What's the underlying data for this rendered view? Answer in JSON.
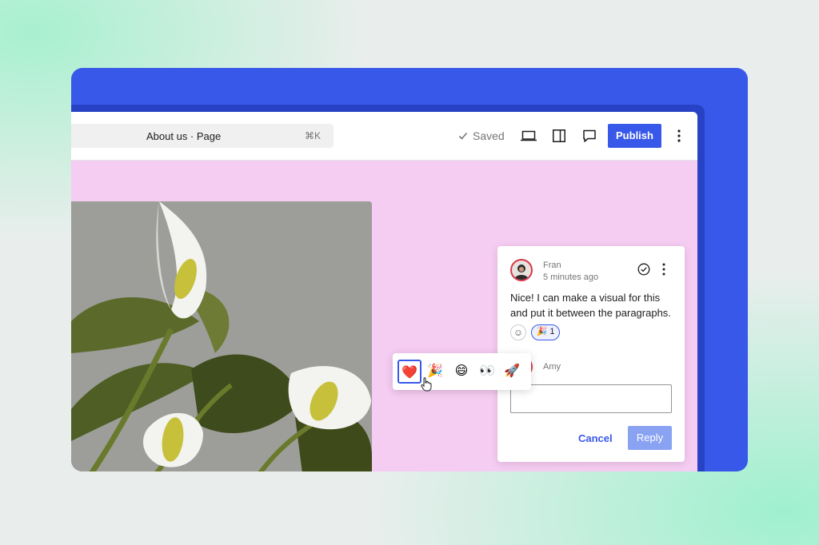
{
  "header": {
    "page_title": "About us · Page",
    "shortcut": "⌘K",
    "saved_label": "Saved",
    "publish_label": "Publish"
  },
  "icons": {
    "device_preview": "laptop-icon",
    "sidebar_toggle": "sidebar-icon",
    "comments": "comment-icon",
    "more": "more-vertical-icon"
  },
  "comment": {
    "author": "Fran",
    "time": "5 minutes ago",
    "text": "Nice! I can make a visual for this and put it between the paragraphs.",
    "reaction": {
      "emoji": "🎉",
      "count": "1"
    }
  },
  "reply": {
    "author": "Amy",
    "cancel_label": "Cancel",
    "reply_label": "Reply"
  },
  "emoji_picker": {
    "options": [
      "❤️",
      "🎉",
      "😄",
      "👀",
      "🚀"
    ],
    "selected_index": 0
  },
  "colors": {
    "accent": "#3858e9",
    "canvas": "#f5ccf2",
    "avatar_ring": "#d8384b"
  }
}
